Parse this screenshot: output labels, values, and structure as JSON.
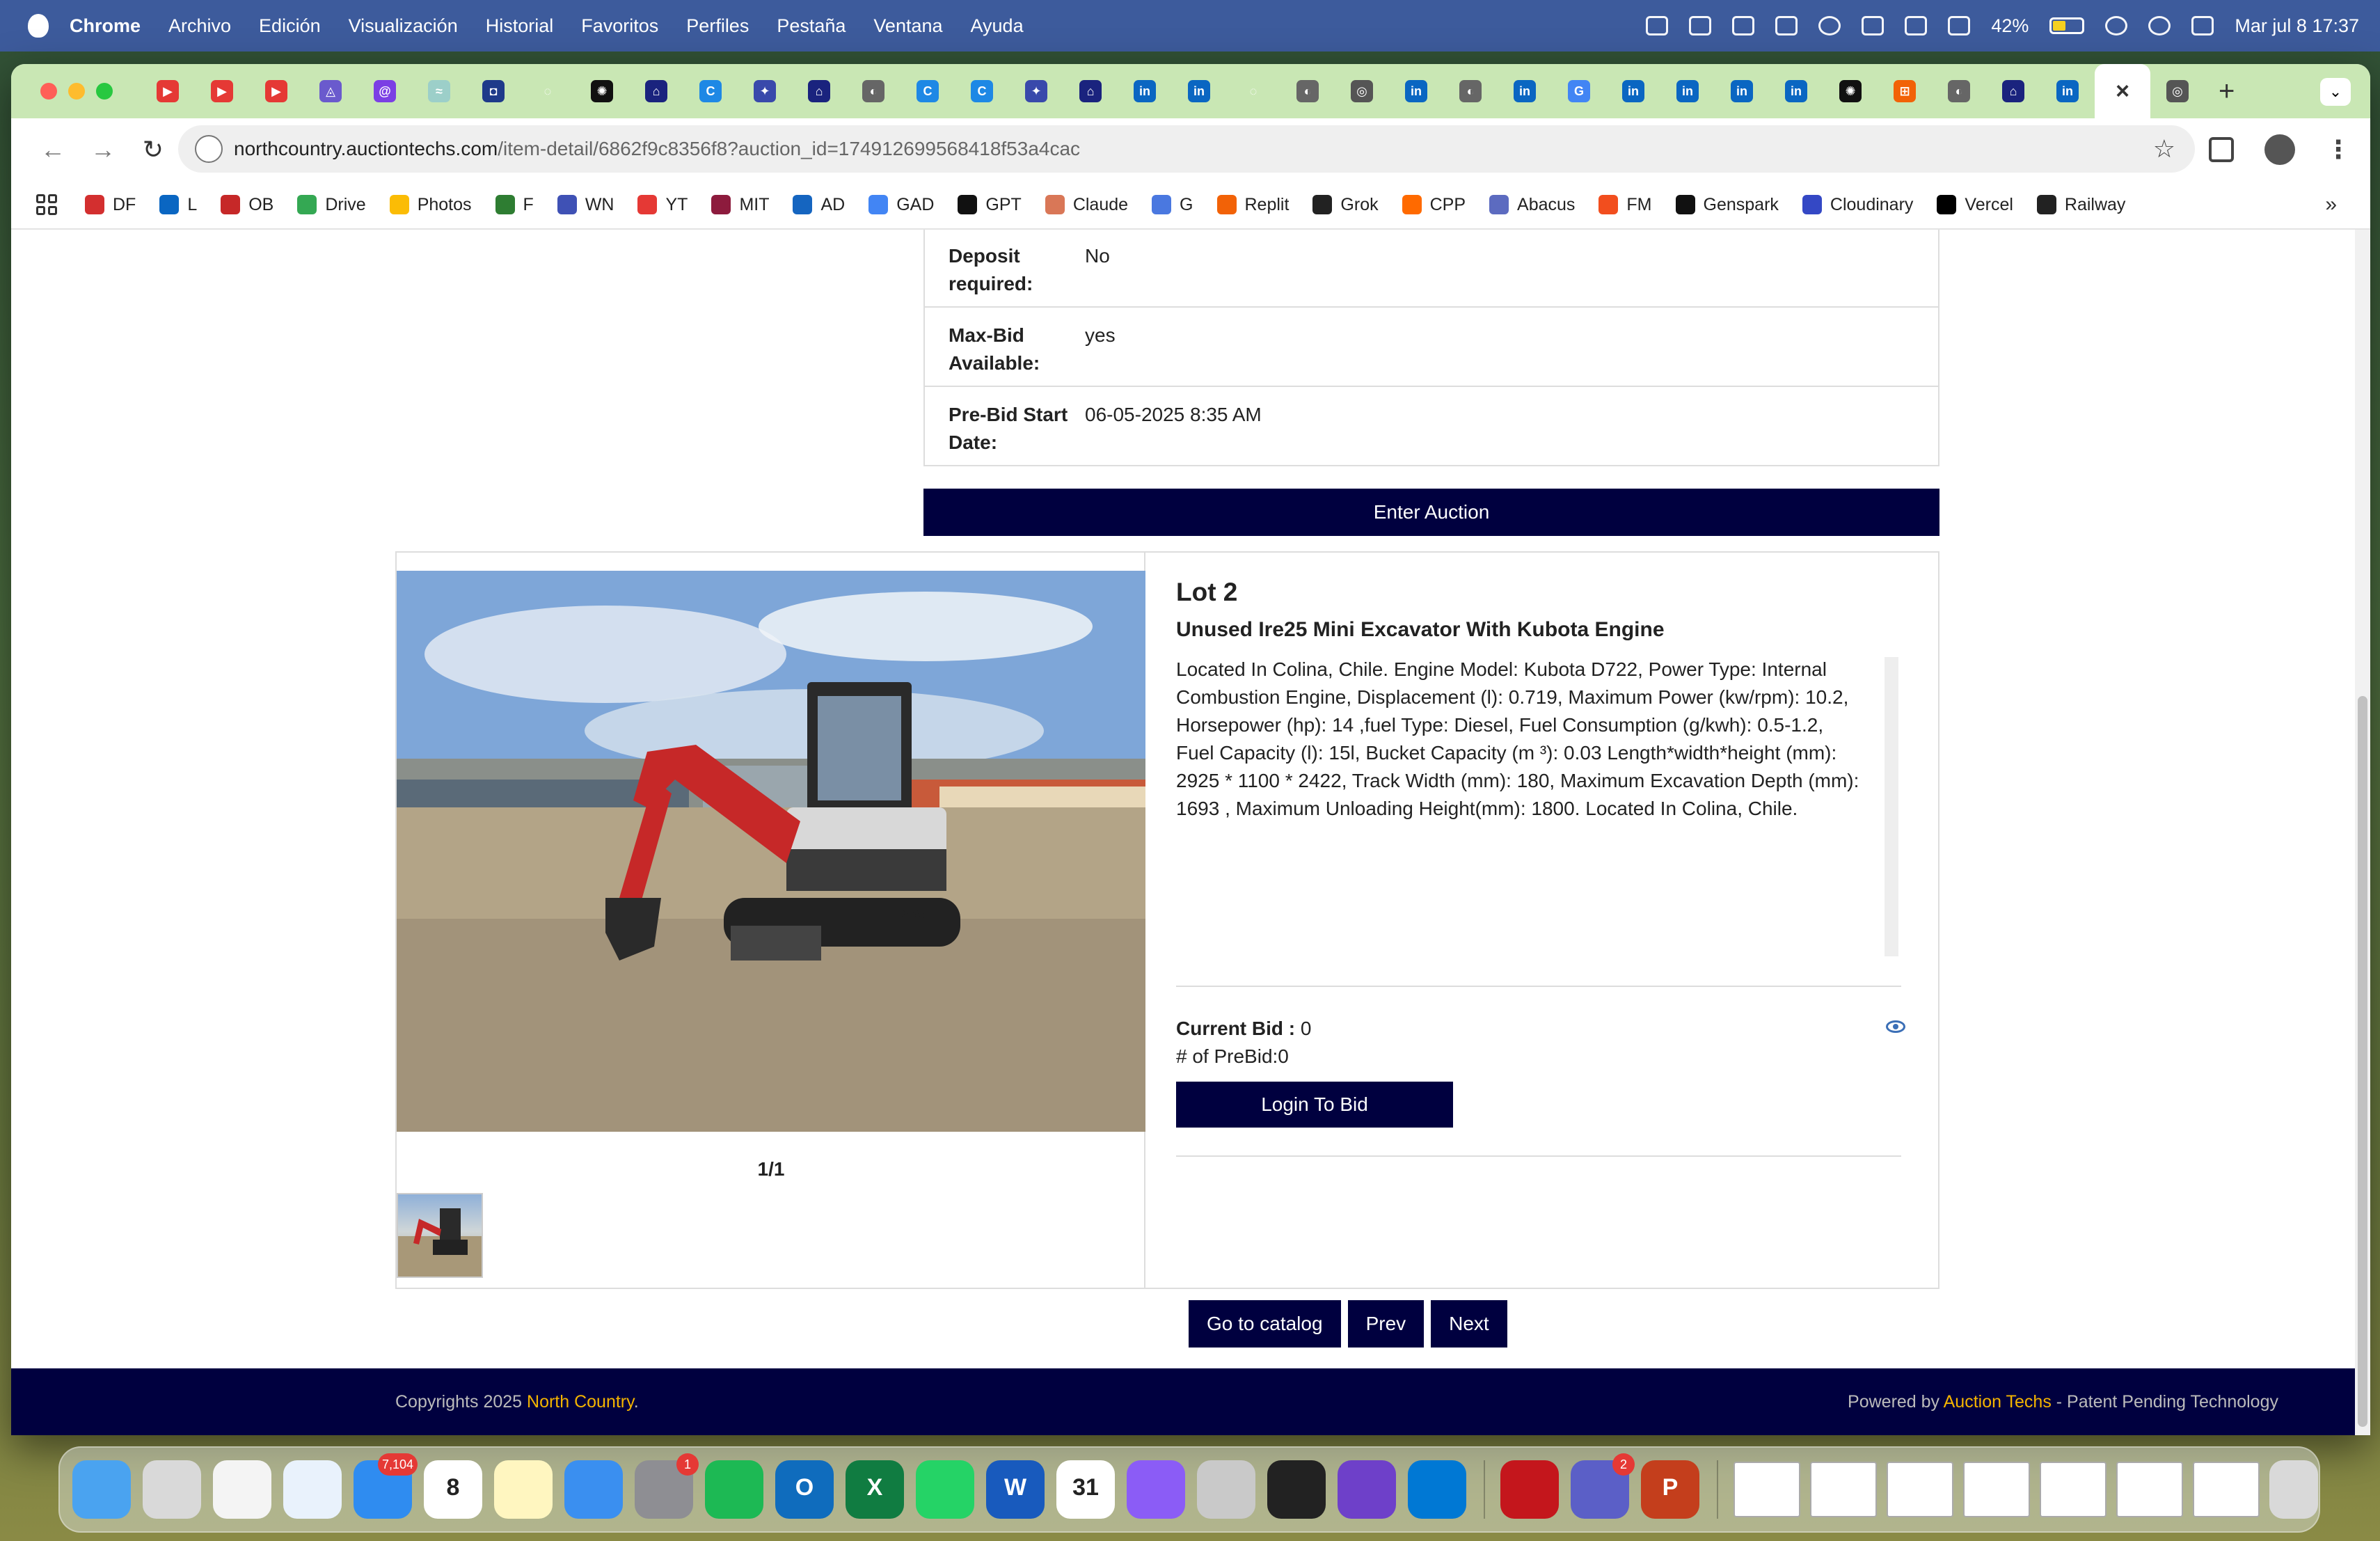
{
  "menubar": {
    "app": "Chrome",
    "items": [
      "Archivo",
      "Edición",
      "Visualización",
      "Historial",
      "Favoritos",
      "Perfiles",
      "Pestaña",
      "Ventana",
      "Ayuda"
    ],
    "battery": "42%",
    "datetime": "Mar jul 8  17:37"
  },
  "tabs": [
    {
      "icon": "youtube-icon",
      "color": "#e53935",
      "glyph": "▶"
    },
    {
      "icon": "youtube-icon",
      "color": "#e53935",
      "glyph": "▶"
    },
    {
      "icon": "youtube-icon",
      "color": "#e53935",
      "glyph": "▶"
    },
    {
      "icon": "arc-icon",
      "color": "#6a5acd",
      "glyph": "◬"
    },
    {
      "icon": "swirl-icon",
      "color": "#7b3fe4",
      "glyph": "@"
    },
    {
      "icon": "wave-icon",
      "color": "#9ccfc9",
      "glyph": "≈"
    },
    {
      "icon": "shield-icon",
      "color": "#1e3a8a",
      "glyph": "◘"
    },
    {
      "icon": "loading-icon",
      "color": "#c9e7b4",
      "glyph": "◌"
    },
    {
      "icon": "openai-icon",
      "color": "#111111",
      "glyph": "✺"
    },
    {
      "icon": "auctiontechs-icon",
      "color": "#1a237e",
      "glyph": "⌂"
    },
    {
      "icon": "c-icon",
      "color": "#1e88e5",
      "glyph": "C"
    },
    {
      "icon": "badge-icon",
      "color": "#3949ab",
      "glyph": "✦"
    },
    {
      "icon": "auctiontechs-icon",
      "color": "#1a237e",
      "glyph": "⌂"
    },
    {
      "icon": "globe-icon",
      "color": "#666666",
      "glyph": "◐"
    },
    {
      "icon": "c-icon",
      "color": "#1e88e5",
      "glyph": "C"
    },
    {
      "icon": "c-icon",
      "color": "#1e88e5",
      "glyph": "C"
    },
    {
      "icon": "badge-icon",
      "color": "#3949ab",
      "glyph": "✦"
    },
    {
      "icon": "auctiontechs-icon",
      "color": "#1a237e",
      "glyph": "⌂"
    },
    {
      "icon": "linkedin-icon",
      "color": "#0a66c2",
      "glyph": "in"
    },
    {
      "icon": "linkedin-icon",
      "color": "#0a66c2",
      "glyph": "in"
    },
    {
      "icon": "loading-icon",
      "color": "#c9e7b4",
      "glyph": "◌"
    },
    {
      "icon": "globe-icon",
      "color": "#666666",
      "glyph": "◐"
    },
    {
      "icon": "chrome-icon",
      "color": "#555555",
      "glyph": "◎"
    },
    {
      "icon": "linkedin-icon",
      "color": "#0a66c2",
      "glyph": "in"
    },
    {
      "icon": "globe-icon",
      "color": "#666666",
      "glyph": "◐"
    },
    {
      "icon": "linkedin-icon",
      "color": "#0a66c2",
      "glyph": "in"
    },
    {
      "icon": "google-icon",
      "color": "#4285f4",
      "glyph": "G"
    },
    {
      "icon": "linkedin-icon",
      "color": "#0a66c2",
      "glyph": "in"
    },
    {
      "icon": "linkedin-icon",
      "color": "#0a66c2",
      "glyph": "in"
    },
    {
      "icon": "linkedin-icon",
      "color": "#0a66c2",
      "glyph": "in"
    },
    {
      "icon": "linkedin-icon",
      "color": "#0a66c2",
      "glyph": "in"
    },
    {
      "icon": "openai-icon",
      "color": "#111111",
      "glyph": "✺"
    },
    {
      "icon": "replit-icon",
      "color": "#f26207",
      "glyph": "⊞"
    },
    {
      "icon": "globe-icon",
      "color": "#666666",
      "glyph": "◐"
    },
    {
      "icon": "auctiontechs-icon",
      "color": "#1a237e",
      "glyph": "⌂"
    },
    {
      "icon": "linkedin-icon",
      "color": "#0a66c2",
      "glyph": "in"
    }
  ],
  "address": {
    "host": "northcountry.auctiontechs.com",
    "path": "/item-detail/6862f9c8356f8?auction_id=174912699568418f53a4cac"
  },
  "bookmarks": [
    {
      "label": "DF",
      "color": "#d32f2f"
    },
    {
      "label": "L",
      "color": "#0a66c2"
    },
    {
      "label": "OB",
      "color": "#c62828"
    },
    {
      "label": "Drive",
      "color": "#34a853"
    },
    {
      "label": "Photos",
      "color": "#fbbc05"
    },
    {
      "label": "F",
      "color": "#2e7d32"
    },
    {
      "label": "WN",
      "color": "#3f51b5"
    },
    {
      "label": "YT",
      "color": "#e53935"
    },
    {
      "label": "MIT",
      "color": "#8d1b3d"
    },
    {
      "label": "AD",
      "color": "#1565c0"
    },
    {
      "label": "GAD",
      "color": "#4285f4"
    },
    {
      "label": "GPT",
      "color": "#111111"
    },
    {
      "label": "Claude",
      "color": "#d97757"
    },
    {
      "label": "G",
      "color": "#4a78e0"
    },
    {
      "label": "Replit",
      "color": "#f26207"
    },
    {
      "label": "Grok",
      "color": "#222222"
    },
    {
      "label": "CPP",
      "color": "#ff6a00"
    },
    {
      "label": "Abacus",
      "color": "#5c6bc0"
    },
    {
      "label": "FM",
      "color": "#f24e1e"
    },
    {
      "label": "Genspark",
      "color": "#111111"
    },
    {
      "label": "Cloudinary",
      "color": "#3448c5"
    },
    {
      "label": "Vercel",
      "color": "#000000"
    },
    {
      "label": "Railway",
      "color": "#222222"
    }
  ],
  "info": [
    {
      "key": "Deposit required:",
      "value": "No"
    },
    {
      "key": "Max-Bid Available:",
      "value": "yes"
    },
    {
      "key": "Pre-Bid Start Date:",
      "value": "06-05-2025 8:35 AM"
    }
  ],
  "enter_auction_label": "Enter Auction",
  "lot": {
    "title": "Lot 2",
    "subtitle": "Unused Ire25 Mini Excavator With Kubota Engine",
    "description": "Located In Colina, Chile. Engine Model: Kubota D722, Power Type: Internal Combustion Engine, Displacement (l): 0.719, Maximum Power (kw/rpm): 10.2, Horsepower (hp): 14 ,fuel Type: Diesel, Fuel Consumption (g/kwh): 0.5-1.2, Fuel Capacity (l): 15l, Bucket Capacity (m ³): 0.03 Length*width*height (mm): 2925 * 1100 * 2422, Track Width (mm): 180, Maximum Excavation Depth (mm): 1693 , Maximum Unloading Height(mm): 1800. Located In Colina, Chile.",
    "image_counter": "1/1",
    "machine_label": "IRE25",
    "current_bid_label": "Current Bid :",
    "current_bid_value": "0",
    "prebid_count": "# of PreBid:0",
    "login_label": "Login To Bid"
  },
  "nav": {
    "catalog": "Go to catalog",
    "prev": "Prev",
    "next": "Next"
  },
  "footer": {
    "copyright_prefix": "Copyrights 2025 ",
    "brand": "North Country",
    "copyright_suffix": ".",
    "powered_prefix": "Powered by ",
    "powered_brand": "Auction Techs",
    "powered_suffix": " - Patent Pending Technology"
  },
  "dock": [
    {
      "name": "finder-icon",
      "color": "#4aa3f0",
      "label": ""
    },
    {
      "name": "launchpad-icon",
      "color": "#d9d9d9",
      "label": ""
    },
    {
      "name": "chrome-icon",
      "color": "#f4f4f4",
      "label": ""
    },
    {
      "name": "safari-icon",
      "color": "#e9f2fc",
      "label": ""
    },
    {
      "name": "mail-icon",
      "color": "#2f8cf0",
      "label": "",
      "badge": "7,104"
    },
    {
      "name": "calendar-icon",
      "color": "#ffffff",
      "label": "8"
    },
    {
      "name": "notes-icon",
      "color": "#fff6c0",
      "label": ""
    },
    {
      "name": "keynote-icon",
      "color": "#3a8ff0",
      "label": ""
    },
    {
      "name": "settings-icon",
      "color": "#8e8e93",
      "label": "",
      "badge": "1"
    },
    {
      "name": "spotify-icon",
      "color": "#1db954",
      "label": ""
    },
    {
      "name": "outlook-icon",
      "color": "#0f6cbd",
      "label": "O"
    },
    {
      "name": "excel-icon",
      "color": "#107c41",
      "label": "X"
    },
    {
      "name": "whatsapp-icon",
      "color": "#25d366",
      "label": ""
    },
    {
      "name": "word-icon",
      "color": "#185abd",
      "label": "W"
    },
    {
      "name": "calendar-31-icon",
      "color": "#ffffff",
      "label": "31"
    },
    {
      "name": "arc-icon",
      "color": "#8b5cf6",
      "label": ""
    },
    {
      "name": "iphone-mirroring-icon",
      "color": "#c9c9c9",
      "label": ""
    },
    {
      "name": "replit-icon",
      "color": "#222222",
      "label": ""
    },
    {
      "name": "github-icon",
      "color": "#6e40c9",
      "label": ""
    },
    {
      "name": "vscode-icon",
      "color": "#0078d4",
      "label": ""
    },
    {
      "name": "acrobat-icon",
      "color": "#c4161c",
      "label": ""
    },
    {
      "name": "teams-icon",
      "color": "#5b5fc7",
      "label": "",
      "badge": "2"
    },
    {
      "name": "powerpoint-icon",
      "color": "#c43e1c",
      "label": "P"
    }
  ]
}
